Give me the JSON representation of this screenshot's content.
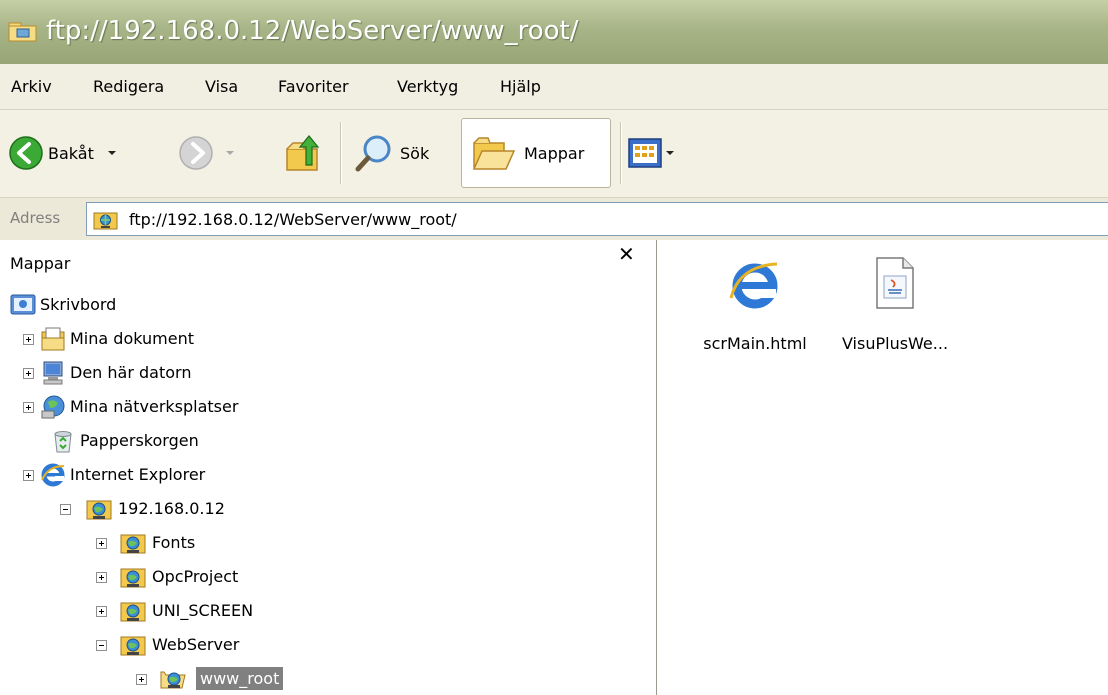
{
  "window": {
    "title": "ftp://192.168.0.12/WebServer/www_root/",
    "title_icon": "ftp-folder-icon"
  },
  "menu": {
    "items": [
      "Arkiv",
      "Redigera",
      "Visa",
      "Favoriter",
      "Verktyg",
      "Hjälp"
    ]
  },
  "toolbar": {
    "back_label": "Bakåt",
    "search_label": "Sök",
    "folders_label": "Mappar",
    "folders_active": true
  },
  "address": {
    "label": "Adress",
    "value": "ftp://192.168.0.12/WebServer/www_root/"
  },
  "folder_pane": {
    "title": "Mappar",
    "close_glyph": "✕",
    "tree": [
      {
        "label": "Skrivbord",
        "icon": "desktop-icon",
        "expander": "none"
      },
      {
        "label": "Mina dokument",
        "icon": "my-documents-icon",
        "expander": "plus"
      },
      {
        "label": "Den här datorn",
        "icon": "my-computer-icon",
        "expander": "plus"
      },
      {
        "label": "Mina nätverksplatser",
        "icon": "network-places-icon",
        "expander": "plus"
      },
      {
        "label": "Papperskorgen",
        "icon": "recycle-bin-icon",
        "expander": "none"
      },
      {
        "label": "Internet Explorer",
        "icon": "internet-explorer-icon",
        "expander": "plus"
      },
      {
        "label": "192.168.0.12",
        "icon": "ftp-server-icon",
        "expander": "minus"
      },
      {
        "label": "Fonts",
        "icon": "ftp-folder-icon",
        "expander": "plus"
      },
      {
        "label": "OpcProject",
        "icon": "ftp-folder-icon",
        "expander": "plus"
      },
      {
        "label": "UNI_SCREEN",
        "icon": "ftp-folder-icon",
        "expander": "plus"
      },
      {
        "label": "WebServer",
        "icon": "ftp-folder-icon",
        "expander": "minus"
      },
      {
        "label": "www_root",
        "icon": "ftp-folder-open-icon",
        "expander": "plus",
        "selected": true
      }
    ]
  },
  "files": [
    {
      "name": "scrMain.html",
      "icon": "html-file-icon"
    },
    {
      "name": "VisuPlusWe...",
      "icon": "java-file-icon"
    }
  ]
}
